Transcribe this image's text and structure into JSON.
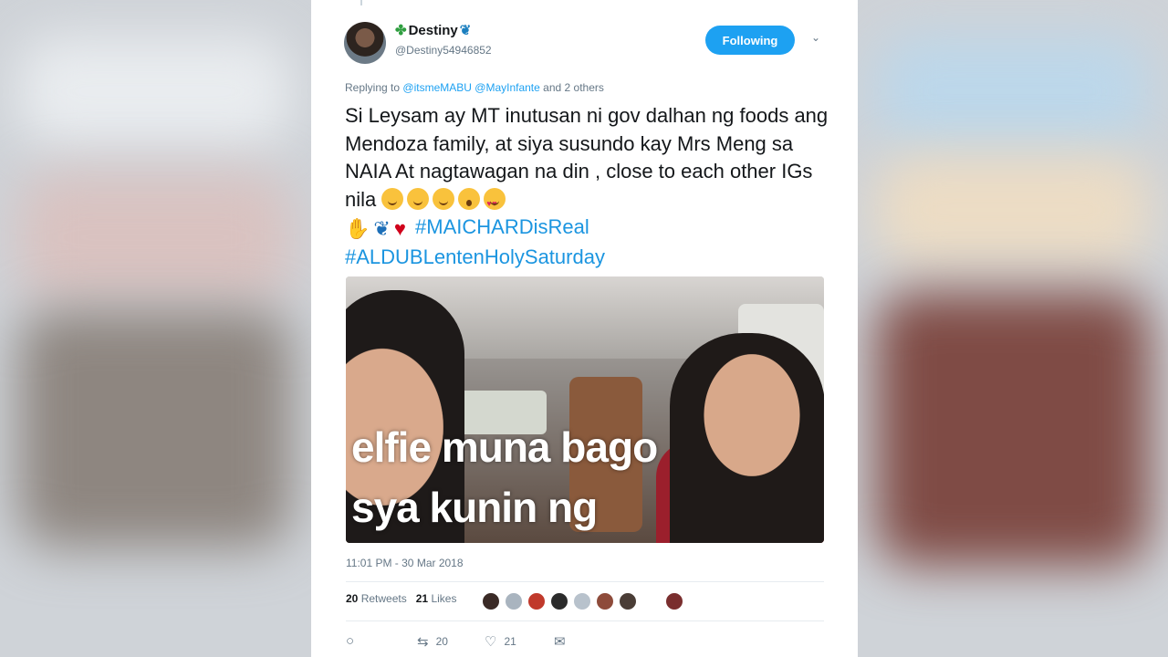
{
  "tweet": {
    "author_name": "Destiny",
    "author_handle": "@Destiny54946852",
    "follow_button_label": "Following",
    "replying_prefix": "Replying to",
    "replying_to": [
      "@itsmeMABU",
      "@MayInfante"
    ],
    "replying_suffix": "and 2 others",
    "text": "Si Leysam ay MT inutusan ni gov dalhan ng foods ang Mendoza family, at siya susundo kay Mrs Meng sa NAIA At nagtawagan na din , close to each other IGs nila",
    "hashtags": [
      "#MAICHARDisReal",
      "#ALDUBLentenHolySaturday"
    ],
    "emojis": [
      "smiling-face-blushing",
      "upside-down-face",
      "winking-face",
      "astonished-face",
      "heart-eyes-face",
      "folded-hands",
      "butterfly",
      "red-heart"
    ],
    "media_caption_lines": [
      "elfie muna bago",
      "sya kunin ng"
    ],
    "timestamp": "11:01 PM - 30 Mar 2018",
    "retweets_count": "20",
    "retweets_label": "Retweets",
    "likes_count": "21",
    "likes_label": "Likes",
    "action_retweet_count": "20",
    "action_like_count": "21"
  },
  "icons": {
    "name_prefix": "four-leaf-clover-icon",
    "name_suffix": "butterfly-icon",
    "menu": "chevron-down-icon",
    "reply": "reply-icon",
    "retweet": "retweet-icon",
    "like": "heart-icon",
    "dm": "envelope-icon"
  },
  "colors": {
    "accent": "#1da1f2",
    "hashtag": "#1b95e0",
    "muted": "#657786"
  }
}
